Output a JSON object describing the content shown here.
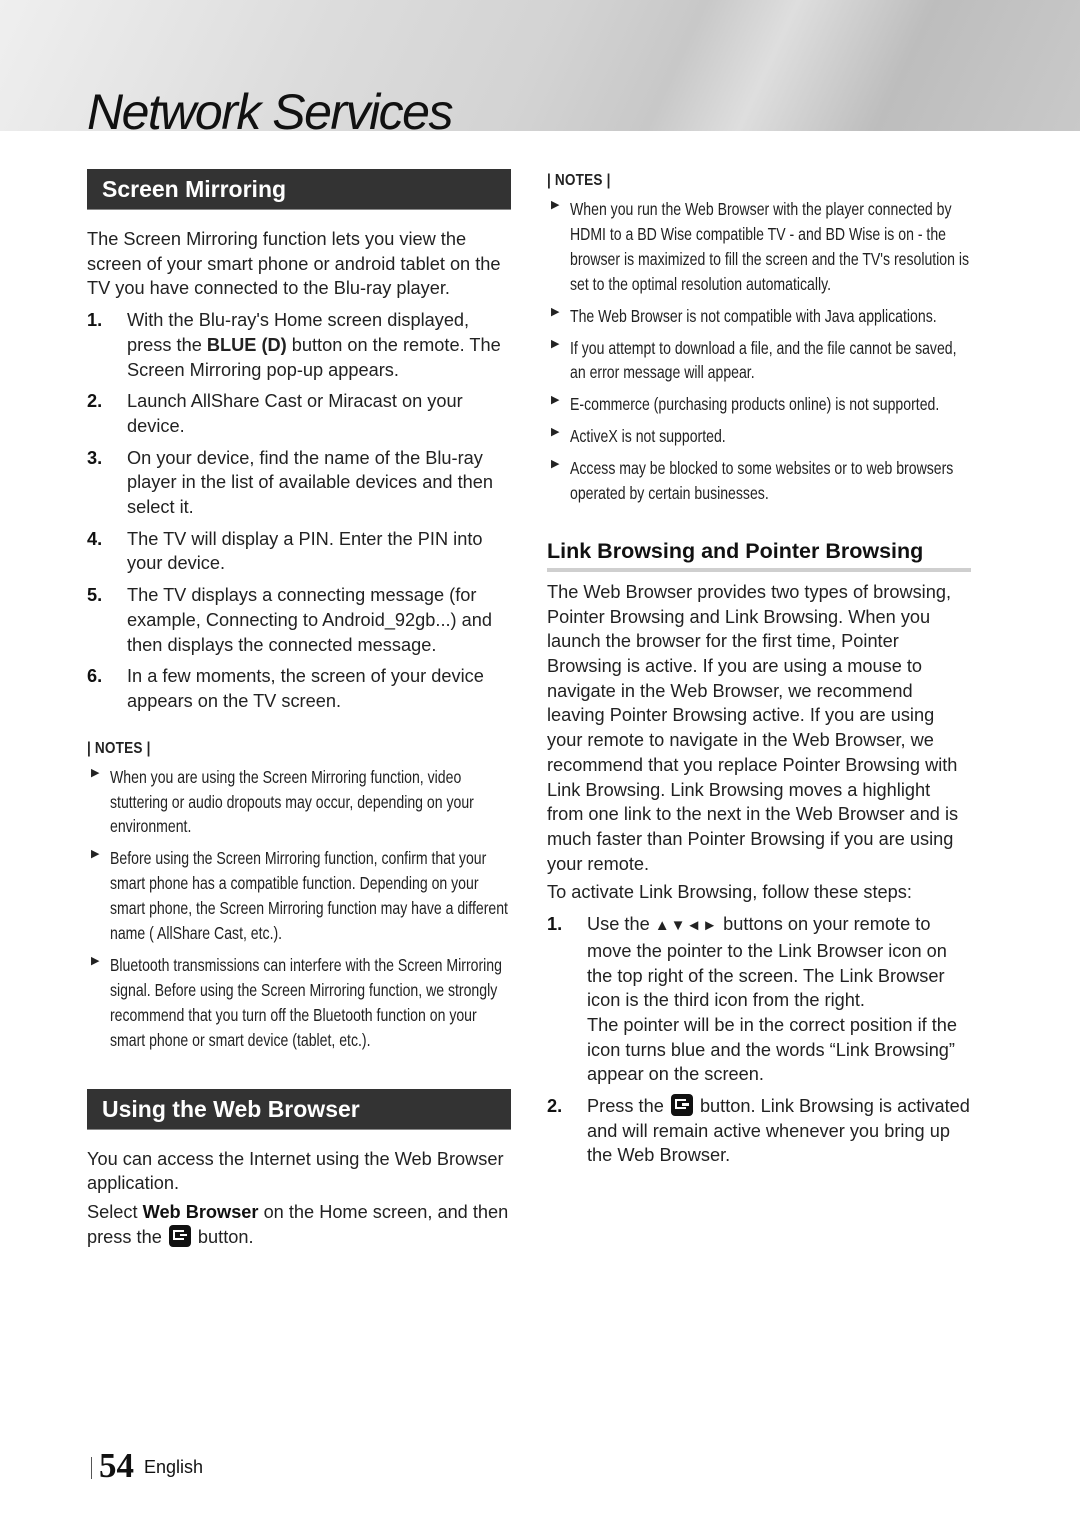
{
  "header": {
    "title": "Network Services"
  },
  "left": {
    "screen_mirroring": {
      "heading": "Screen Mirroring",
      "intro": "The Screen Mirroring function lets you view the screen of your smart phone or android tablet on the TV you have connected to the Blu-ray player.",
      "steps": [
        {
          "num": "1.",
          "pre": "With the Blu-ray's Home screen displayed, press the ",
          "bold": "BLUE (D)",
          "post": " button on the remote. The Screen Mirroring pop-up appears."
        },
        {
          "num": "2.",
          "text": "Launch AllShare Cast or Miracast on your device."
        },
        {
          "num": "3.",
          "text": "On your device, find the name of the Blu-ray player in the list of available devices and then select it."
        },
        {
          "num": "4.",
          "text": "The TV will display a PIN. Enter the PIN into your device."
        },
        {
          "num": "5.",
          "text": "The TV displays a connecting message (for example, Connecting to Android_92gb...) and then displays the connected message."
        },
        {
          "num": "6.",
          "text": "In a few moments, the screen of your device appears on the TV screen."
        }
      ],
      "notes_title": "| NOTES |",
      "notes": [
        "When you are using the Screen Mirroring function, video stuttering or audio dropouts may occur, depending on your environment.",
        "Before using the Screen Mirroring function, confirm that your smart phone has a compatible function. Depending on your smart phone, the Screen Mirroring function may have a different name ( AllShare Cast, etc.).",
        "Bluetooth transmissions can interfere with the Screen Mirroring signal. Before using the Screen Mirroring function, we strongly recommend that you turn off the Bluetooth function on your smart phone or smart device (tablet, etc.)."
      ]
    },
    "web_browser": {
      "heading": "Using the Web Browser",
      "intro": "You can access the Internet using the Web Browser application.",
      "select_pre": "Select ",
      "select_bold": "Web Browser",
      "select_mid": " on the Home screen, and then press the ",
      "select_post": " button.",
      "enter_icon": "enter-button-icon"
    }
  },
  "right": {
    "notes_title": "| NOTES |",
    "notes": [
      "When you run the Web Browser with the player connected by HDMI to a BD Wise compatible TV - and BD Wise is on - the browser is maximized to fill the screen and the TV's resolution is set to the optimal resolution automatically.",
      "The Web Browser is not compatible with Java applications.",
      "If you attempt to download a file, and the file cannot be saved, an error message will appear.",
      "E-commerce (purchasing products online) is not supported.",
      "ActiveX is not supported.",
      "Access may be blocked to some websites or to web browsers operated by certain businesses."
    ],
    "link_browsing": {
      "heading": "Link Browsing and Pointer Browsing",
      "body": "The Web Browser provides two types of browsing, Pointer Browsing and Link Browsing. When you launch the browser for the first time, Pointer Browsing is active. If you are using a mouse to navigate in the Web Browser, we recommend leaving Pointer Browsing active. If you are using your remote to navigate in the Web Browser, we recommend that you replace Pointer Browsing with Link Browsing. Link Browsing moves a highlight from one link to the next in the Web Browser and is much faster than Pointer Browsing if you are using your remote.",
      "activate_intro": "To activate Link Browsing, follow these steps:",
      "steps": [
        {
          "num": "1.",
          "pre": "Use the ",
          "arrows": "▲▼◄►",
          "post": " buttons on your remote to move the pointer to the Link Browser icon on the top right of the screen. The Link Browser icon is the third icon from the right.",
          "extra": "The pointer will be in the correct position if the icon turns blue and the words “Link Browsing” appear on the screen."
        },
        {
          "num": "2.",
          "pre": "Press the ",
          "post": " button. Link Browsing is activated and will remain active whenever you bring up the Web Browser."
        }
      ]
    }
  },
  "footer": {
    "page_number": "54",
    "language": "English"
  },
  "colors": {
    "section_bar": "#333333",
    "subhead_rule": "#cfcfcf"
  }
}
